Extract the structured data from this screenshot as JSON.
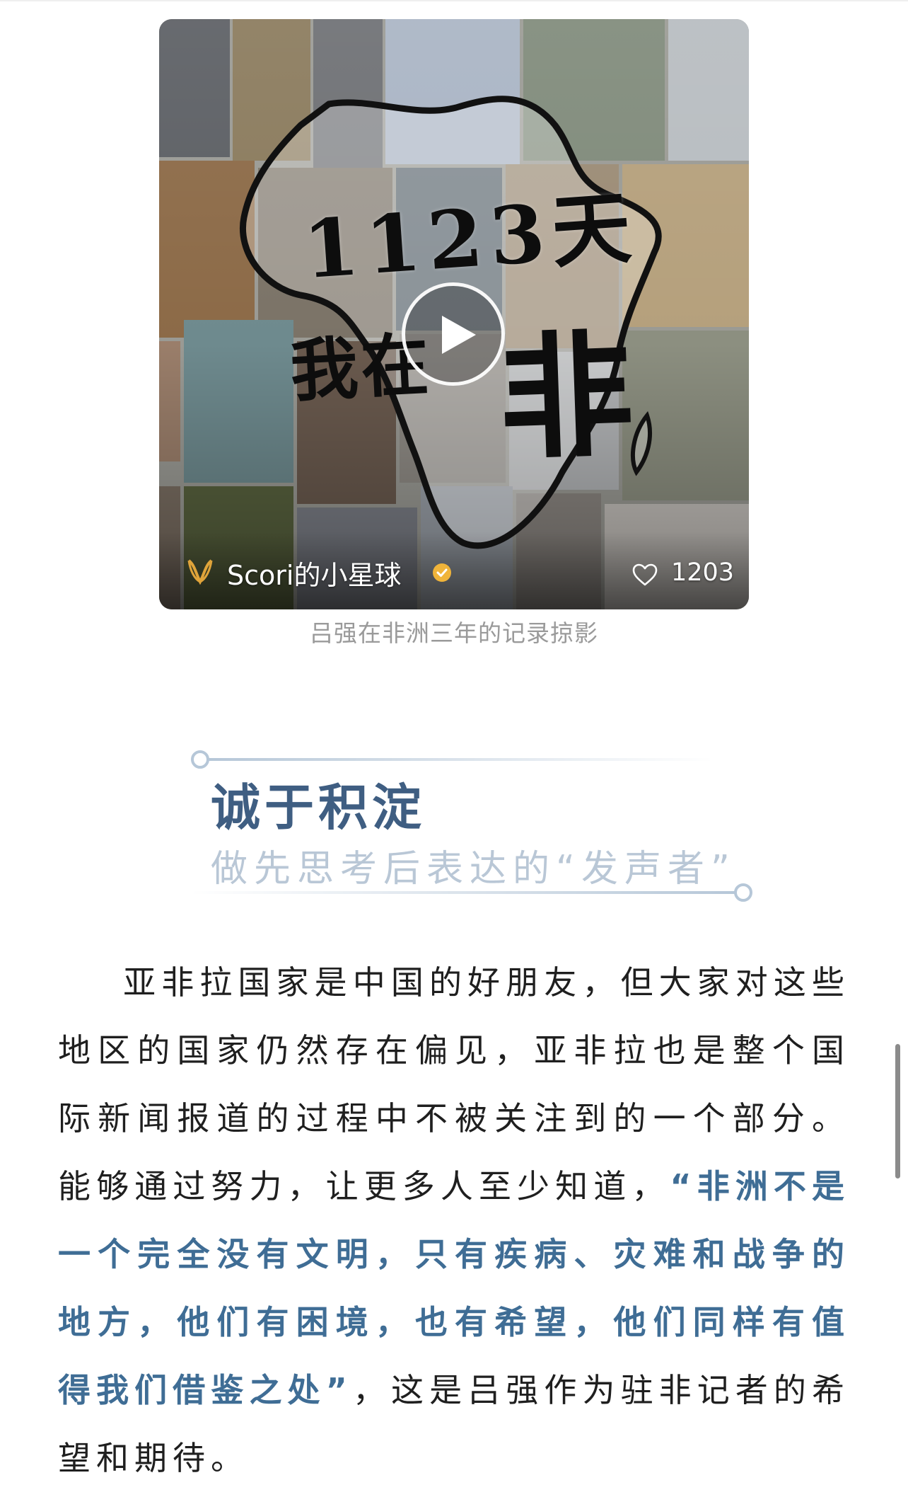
{
  "video": {
    "title_main": "1123天",
    "title_sub": "我在",
    "title_big_char": "非",
    "account_name": "Scori的小星球",
    "like_count": "1203",
    "icons": [
      "play-icon",
      "account-logo-icon",
      "verified-icon",
      "heart-icon"
    ]
  },
  "caption": "吕强在非洲三年的记录掠影",
  "section": {
    "title": "诚于积淀",
    "subtitle": "做先思考后表达的“发声者”"
  },
  "body": {
    "part1": "亚非拉国家是中国的好朋友，但大家对这些地区的国家仍然存在偏见，亚非拉也是整个国际新闻报道的过程中不被关注到的一个部分。能够通过努力，让更多人至少知道，",
    "quote": "“非洲不是一个完全没有文明，只有疾病、灾难和战争的地方，他们有困境，也有希望，他们同样有值得我们借鉴之处”",
    "part2": "，这是吕强作为驻非记者的希望和期待。"
  },
  "colors": {
    "accent": "#3f5e82",
    "subtitle": "#b9c7d6",
    "quote": "#3f6d95",
    "caption": "#9a9a9a"
  }
}
